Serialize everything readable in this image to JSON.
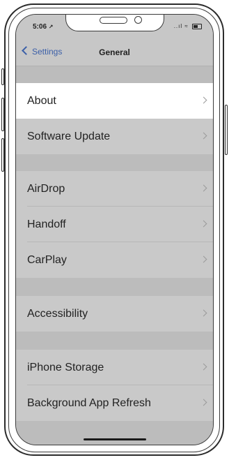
{
  "status_bar": {
    "time": "5:06",
    "signal": "..ıl",
    "wifi": "≈"
  },
  "nav": {
    "back_label": "Settings",
    "title": "General"
  },
  "sections": [
    {
      "items": [
        {
          "label": "About",
          "highlighted": true
        },
        {
          "label": "Software Update",
          "highlighted": false
        }
      ]
    },
    {
      "items": [
        {
          "label": "AirDrop"
        },
        {
          "label": "Handoff"
        },
        {
          "label": "CarPlay"
        }
      ]
    },
    {
      "items": [
        {
          "label": "Accessibility"
        }
      ]
    },
    {
      "items": [
        {
          "label": "iPhone Storage"
        },
        {
          "label": "Background App Refresh"
        }
      ]
    }
  ],
  "colors": {
    "accent": "#3b5fa8",
    "highlight_row": "#ffffff",
    "dimmed_row": "#c9c9c9"
  }
}
